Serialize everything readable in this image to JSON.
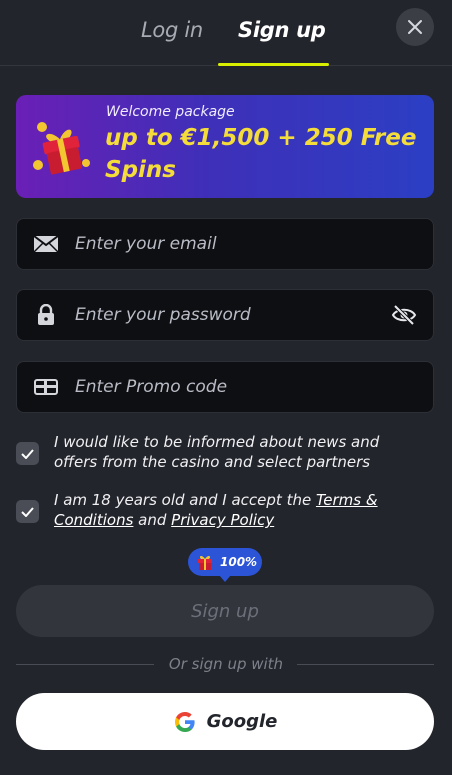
{
  "tabs": {
    "login": "Log in",
    "signup": "Sign up"
  },
  "banner": {
    "subtitle": "Welcome package",
    "headline": "up to €1,500 + 250 Free Spins"
  },
  "fields": {
    "email_placeholder": "Enter your email",
    "password_placeholder": "Enter your password",
    "promo_placeholder": "Enter Promo code"
  },
  "consents": {
    "news_text": "I would like to be informed about news and offers from the casino and select partners",
    "age_prefix": "I am 18 years old and I accept the ",
    "terms_link": "Terms & Conditions",
    "and_text": " and ",
    "privacy_link": "Privacy Policy"
  },
  "badge": {
    "label": "100%"
  },
  "actions": {
    "signup_label": "Sign up",
    "divider_text": "Or sign up with",
    "google_label": "Google"
  },
  "icons": {
    "close": "close-icon",
    "gift": "gift-icon",
    "email": "envelope-icon",
    "password": "lock-icon",
    "eye": "eye-off-icon",
    "promo": "ticket-icon",
    "check": "check-icon",
    "google": "google-icon"
  },
  "colors": {
    "background": "#23252c",
    "accent_underline": "#d8f000",
    "banner_headline": "#f4dc3a",
    "badge": "#2b54d6"
  }
}
